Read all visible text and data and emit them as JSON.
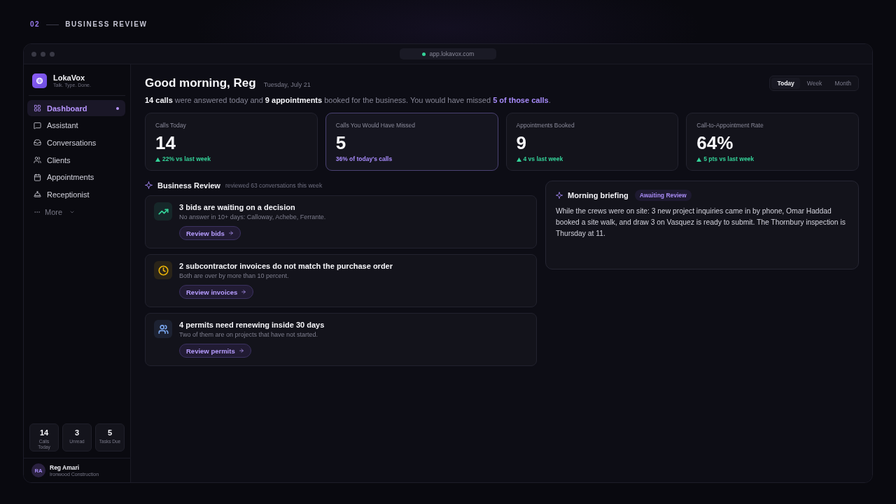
{
  "page_header": {
    "number": "02",
    "title": "BUSINESS REVIEW"
  },
  "browser": {
    "url": "app.lokavox.com"
  },
  "sidebar": {
    "brand": {
      "name": "LokaVox",
      "tagline": "Talk. Type. Done."
    },
    "nav": [
      {
        "label": "Dashboard",
        "selected": true
      },
      {
        "label": "Assistant",
        "selected": false
      },
      {
        "label": "Conversations",
        "selected": false
      },
      {
        "label": "Clients",
        "selected": false
      },
      {
        "label": "Appointments",
        "selected": false
      },
      {
        "label": "Receptionist",
        "selected": false
      }
    ],
    "more": "More",
    "stats": [
      {
        "value": "14",
        "label": "Calls Today"
      },
      {
        "value": "3",
        "label": "Unread"
      },
      {
        "value": "5",
        "label": "Tasks Due"
      }
    ],
    "user": {
      "initials": "RA",
      "name": "Reg Amari",
      "company": "Ironwood Construction"
    }
  },
  "main": {
    "greeting": "Good morning, Reg",
    "date": "Tuesday, July 21",
    "periods": [
      {
        "label": "Today",
        "selected": true
      },
      {
        "label": "Week",
        "selected": false
      },
      {
        "label": "Month",
        "selected": false
      }
    ],
    "summary": [
      {
        "kind": "strong",
        "text": "14 calls"
      },
      {
        "kind": "plain",
        "text": " were answered today and "
      },
      {
        "kind": "strong",
        "text": "9 appointments"
      },
      {
        "kind": "plain",
        "text": " booked for the business. You would have missed "
      },
      {
        "kind": "accent",
        "text": "5 of those calls"
      },
      {
        "kind": "plain",
        "text": "."
      }
    ],
    "kpis": [
      {
        "label": "Calls Today",
        "value": "14",
        "highlighted": false,
        "delta": {
          "kind": "up",
          "text": "22% vs last week"
        }
      },
      {
        "label": "Calls You Would Have Missed",
        "value": "5",
        "highlighted": true,
        "delta": {
          "kind": "share",
          "text": "36% of today's calls"
        }
      },
      {
        "label": "Appointments Booked",
        "value": "9",
        "highlighted": false,
        "delta": {
          "kind": "up",
          "text": "4 vs last week"
        }
      },
      {
        "label": "Call-to-Appointment Rate",
        "value": "64%",
        "highlighted": false,
        "delta": {
          "kind": "up",
          "text": "5 pts vs last week"
        }
      }
    ],
    "review": {
      "title": "Business Review",
      "subtitle": "reviewed 63 conversations this week",
      "items": [
        {
          "title": "3 bids are waiting on a decision",
          "description": "No answer in 10+ days: Calloway, Achebe, Ferrante.",
          "action": "Review bids",
          "color": "#34d399"
        },
        {
          "title": "2 subcontractor invoices do not match the purchase order",
          "description": "Both are over by more than 10 percent.",
          "action": "Review invoices",
          "color": "#eab308"
        },
        {
          "title": "4 permits need renewing inside 30 days",
          "description": "Two of them are on projects that have not started.",
          "action": "Review permits",
          "color": "#7aa7f0"
        }
      ]
    },
    "briefing": {
      "title": "Morning briefing",
      "status": "Awaiting Review",
      "text": "While the crews were on site: 3 new project inquiries came in by phone, Omar Haddad booked a site walk, and draw 3 on Vasquez is ready to submit. The Thornbury inspection is Thursday at 11."
    }
  }
}
